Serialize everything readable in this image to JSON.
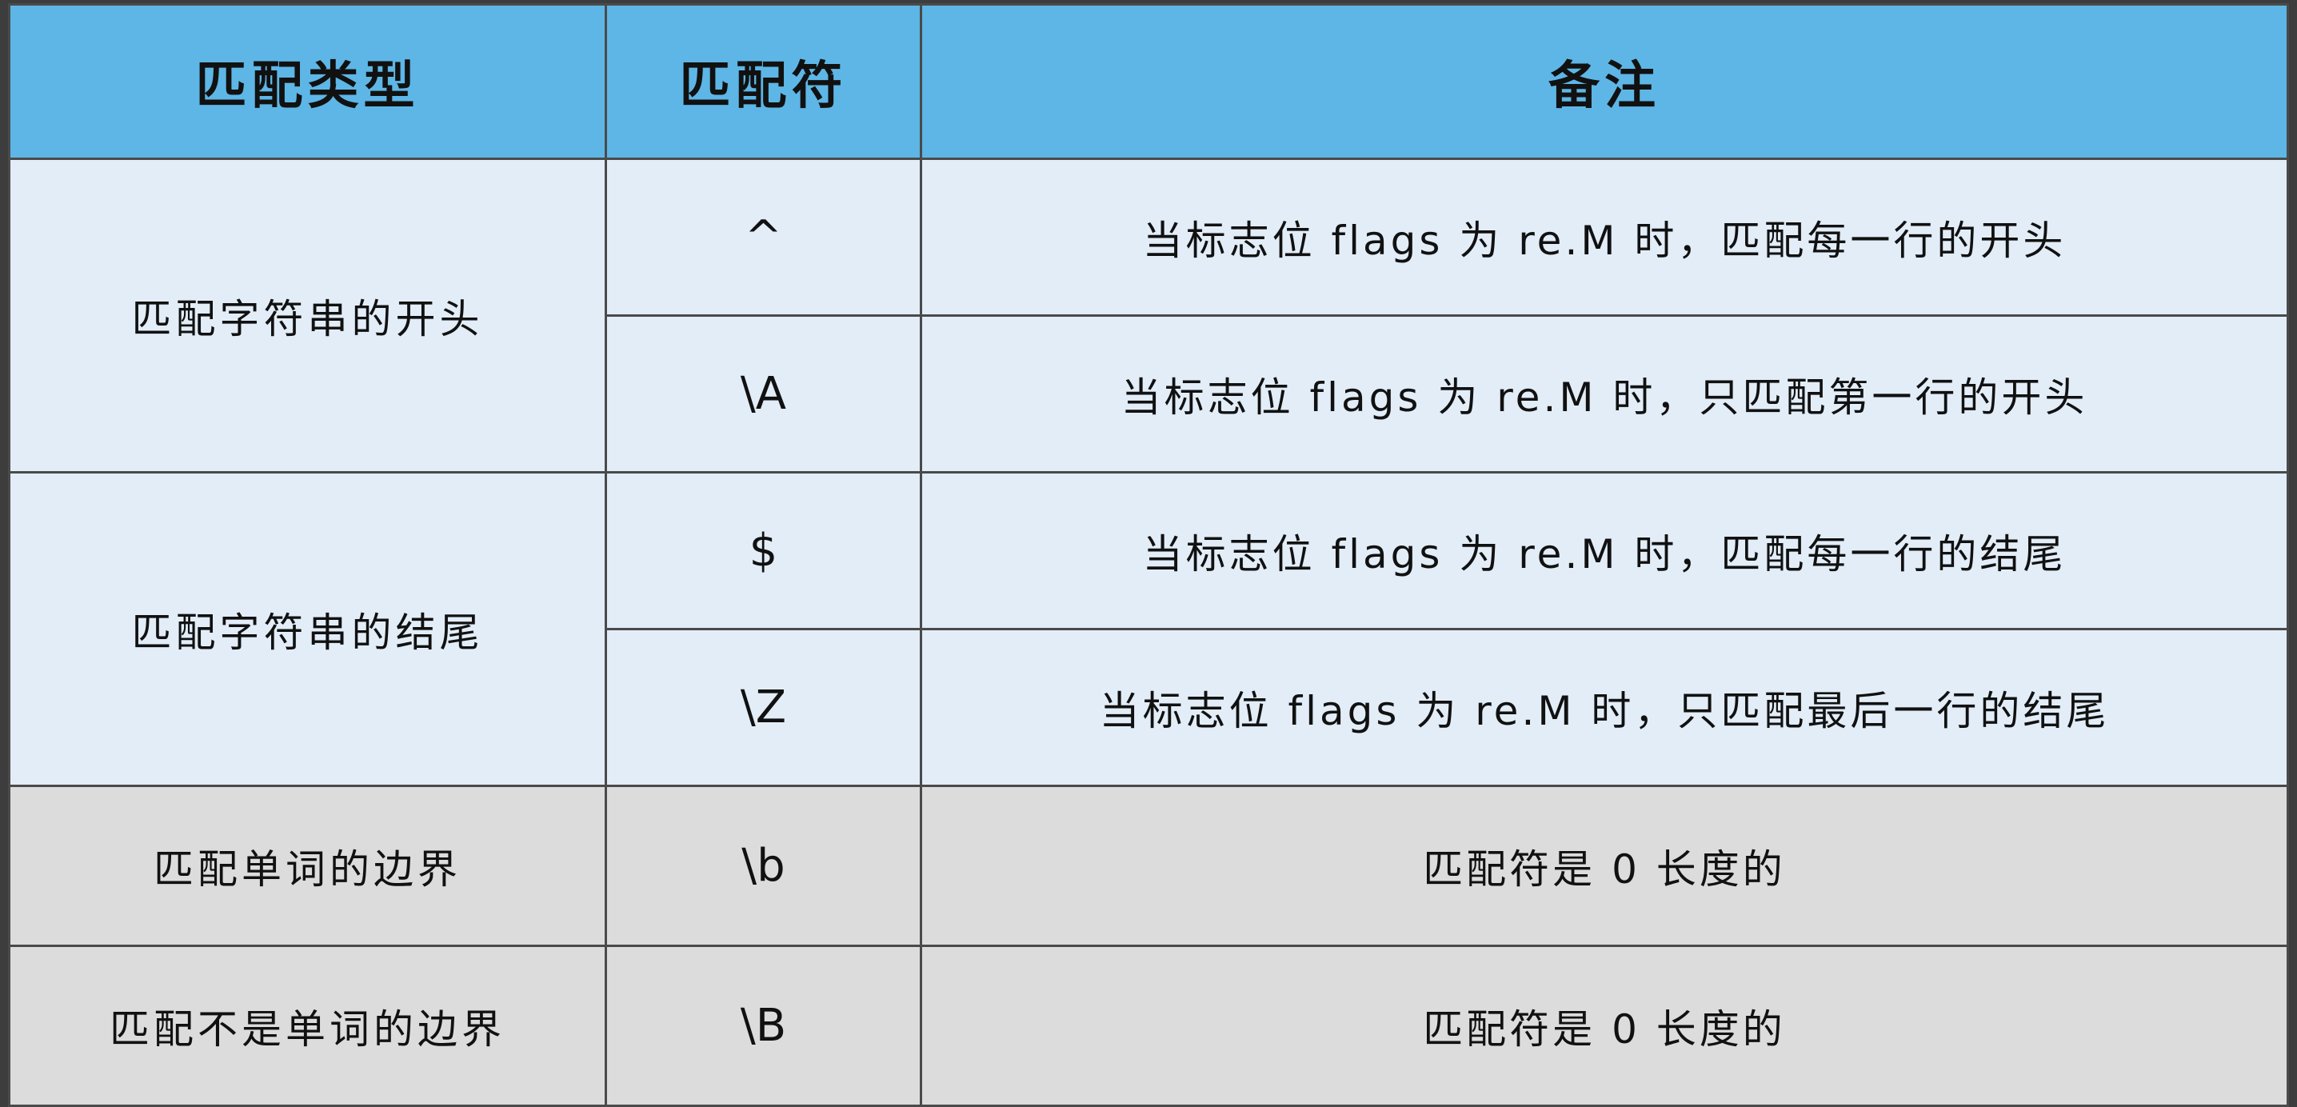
{
  "table": {
    "headers": {
      "type": "匹配类型",
      "symbol": "匹配符",
      "note": "备注"
    },
    "rows": [
      {
        "type": "匹配字符串的开头",
        "symbol": "^",
        "note": "当标志位 flags 为 re.M 时，匹配每一行的开头",
        "shade": "blue"
      },
      {
        "type": "匹配字符串的开头",
        "symbol": "\\A",
        "note": "当标志位 flags 为 re.M 时，只匹配第一行的开头",
        "shade": "blue"
      },
      {
        "type": "匹配字符串的结尾",
        "symbol": "$",
        "note": "当标志位 flags 为 re.M 时，匹配每一行的结尾",
        "shade": "blue"
      },
      {
        "type": "匹配字符串的结尾",
        "symbol": "\\Z",
        "note": "当标志位 flags 为 re.M 时，只匹配最后一行的结尾",
        "shade": "blue"
      },
      {
        "type": "匹配单词的边界",
        "symbol": "\\b",
        "note": "匹配符是 0 长度的",
        "shade": "gray"
      },
      {
        "type": "匹配不是单词的边界",
        "symbol": "\\B",
        "note": "匹配符是 0 长度的",
        "shade": "gray"
      }
    ]
  },
  "colors": {
    "header_bg": "#5db6e6",
    "blue_row_bg": "#e2edf8",
    "gray_row_bg": "#dcdcdc",
    "border": "#4a4a4a",
    "background": "#3d3d3d"
  }
}
